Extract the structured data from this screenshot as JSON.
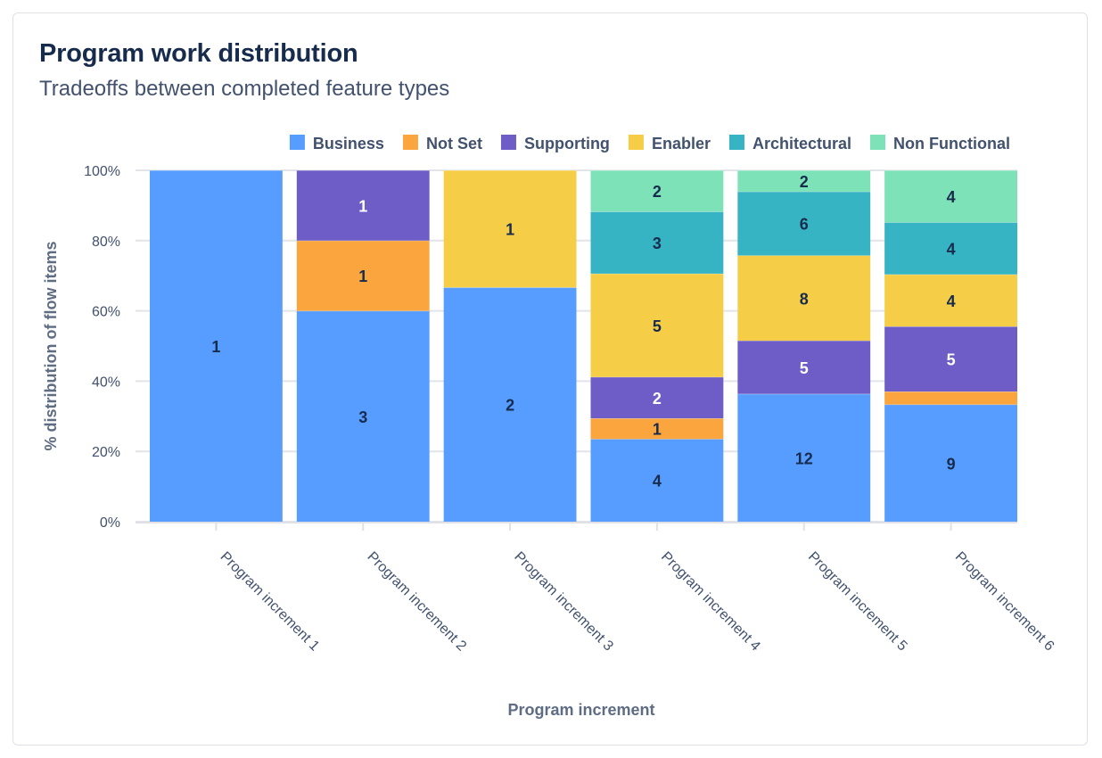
{
  "header": {
    "title": "Program work distribution",
    "subtitle": "Tradeoffs between completed feature types"
  },
  "chart_data": {
    "type": "bar",
    "stacked": true,
    "normalized_percent": true,
    "title": "Program work distribution",
    "subtitle": "Tradeoffs between completed feature types",
    "xlabel": "Program increment",
    "ylabel": "% distribution of flow items",
    "ylim": [
      0,
      100
    ],
    "yticks": [
      "0%",
      "20%",
      "40%",
      "60%",
      "80%",
      "100%"
    ],
    "grid": true,
    "legend_position": "top-right",
    "categories": [
      "Program increment 1",
      "Program increment 2",
      "Program increment 3",
      "Program increment 4",
      "Program increment 5",
      "Program increment 6"
    ],
    "series": [
      {
        "name": "Business",
        "color": "#579dff",
        "label_color": "#172b4d",
        "values": [
          1,
          3,
          2,
          4,
          12,
          9
        ]
      },
      {
        "name": "Not Set",
        "color": "#faa53d",
        "label_color": "#172b4d",
        "values": [
          0,
          1,
          0,
          1,
          0,
          1
        ],
        "hidden_labels": [
          5
        ]
      },
      {
        "name": "Supporting",
        "color": "#6e5dc6",
        "label_color": "#ffffff",
        "values": [
          0,
          1,
          0,
          2,
          5,
          5
        ]
      },
      {
        "name": "Enabler",
        "color": "#f5cd47",
        "label_color": "#172b4d",
        "values": [
          0,
          0,
          1,
          5,
          8,
          4
        ]
      },
      {
        "name": "Architectural",
        "color": "#37b4c3",
        "label_color": "#172b4d",
        "values": [
          0,
          0,
          0,
          3,
          6,
          4
        ]
      },
      {
        "name": "Non Functional",
        "color": "#7ee2b8",
        "label_color": "#172b4d",
        "values": [
          0,
          0,
          0,
          2,
          2,
          4
        ]
      }
    ]
  }
}
